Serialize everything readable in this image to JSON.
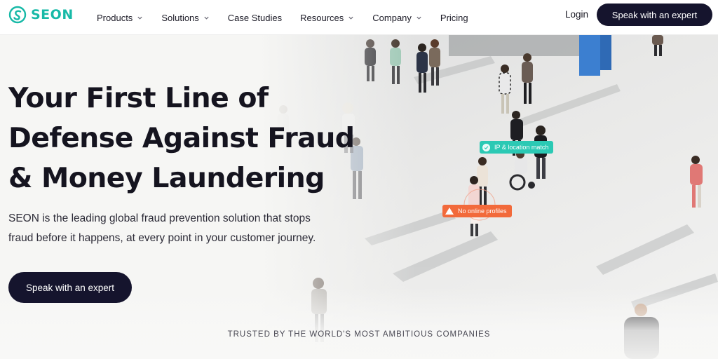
{
  "brand": {
    "name": "SEON",
    "color": "#17b9a7"
  },
  "nav": {
    "items": [
      {
        "label": "Products",
        "has_dropdown": true
      },
      {
        "label": "Solutions",
        "has_dropdown": true
      },
      {
        "label": "Case Studies",
        "has_dropdown": false
      },
      {
        "label": "Resources",
        "has_dropdown": true
      },
      {
        "label": "Company",
        "has_dropdown": true
      },
      {
        "label": "Pricing",
        "has_dropdown": false
      }
    ],
    "login": "Login",
    "cta": "Speak with an expert"
  },
  "hero": {
    "title_lines": [
      "Your First Line of",
      "Defense Against Fraud",
      "& Money Laundering"
    ],
    "subtitle_lines": [
      "SEON is the leading global fraud prevention solution that stops",
      "fraud before it happens, at every point in your customer journey."
    ],
    "cta": "Speak with an expert",
    "tags": {
      "ip_match": "IP & location match",
      "no_profiles": "No online profiles"
    }
  },
  "trusted": "TRUSTED BY THE WORLD'S MOST AMBITIOUS COMPANIES",
  "colors": {
    "primary_dark": "#15142d",
    "tag_teal": "#2bc9b4",
    "tag_orange": "#f26a3b"
  },
  "icons": [
    "seon-logo-icon",
    "chevron-down-icon",
    "check-circle-icon",
    "warning-icon"
  ]
}
